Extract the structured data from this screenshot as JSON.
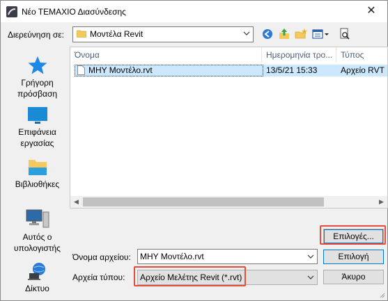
{
  "window": {
    "title": "Νέο ΤΕΜΑΧΙΟ Διασύνδεσης"
  },
  "lookin": {
    "label": "Διερεύνηση σε:",
    "value": "Μοντέλα Revit"
  },
  "places": [
    {
      "label": "Γρήγορη πρόσβαση"
    },
    {
      "label": "Επιφάνεια εργασίας"
    },
    {
      "label": "Βιβλιοθήκες"
    },
    {
      "label": "Αυτός ο υπολογιστής"
    },
    {
      "label": "Δίκτυο"
    }
  ],
  "file_list": {
    "columns": [
      "Όνομα",
      "Ημερομηνία τρο...",
      "Τύπος"
    ],
    "rows": [
      {
        "name": "ΜΗΥ Μοντέλο.rvt",
        "date": "13/5/21 15:33",
        "type": "Αρχείο RVT"
      }
    ]
  },
  "buttons": {
    "options": "Επιλογές...",
    "open": "Επιλογή",
    "cancel": "Άκυρο"
  },
  "filename": {
    "label": "Όνομα αρχείου:",
    "value": "ΜΗΥ Μοντέλο.rvt"
  },
  "filetype": {
    "label": "Αρχεία τύπου:",
    "value": "Αρχείο Μελέτης Revit (*.rvt)"
  },
  "colors": {
    "highlight": "#e84b3a",
    "selection": "#cce8ff",
    "focus": "#0078d7"
  }
}
